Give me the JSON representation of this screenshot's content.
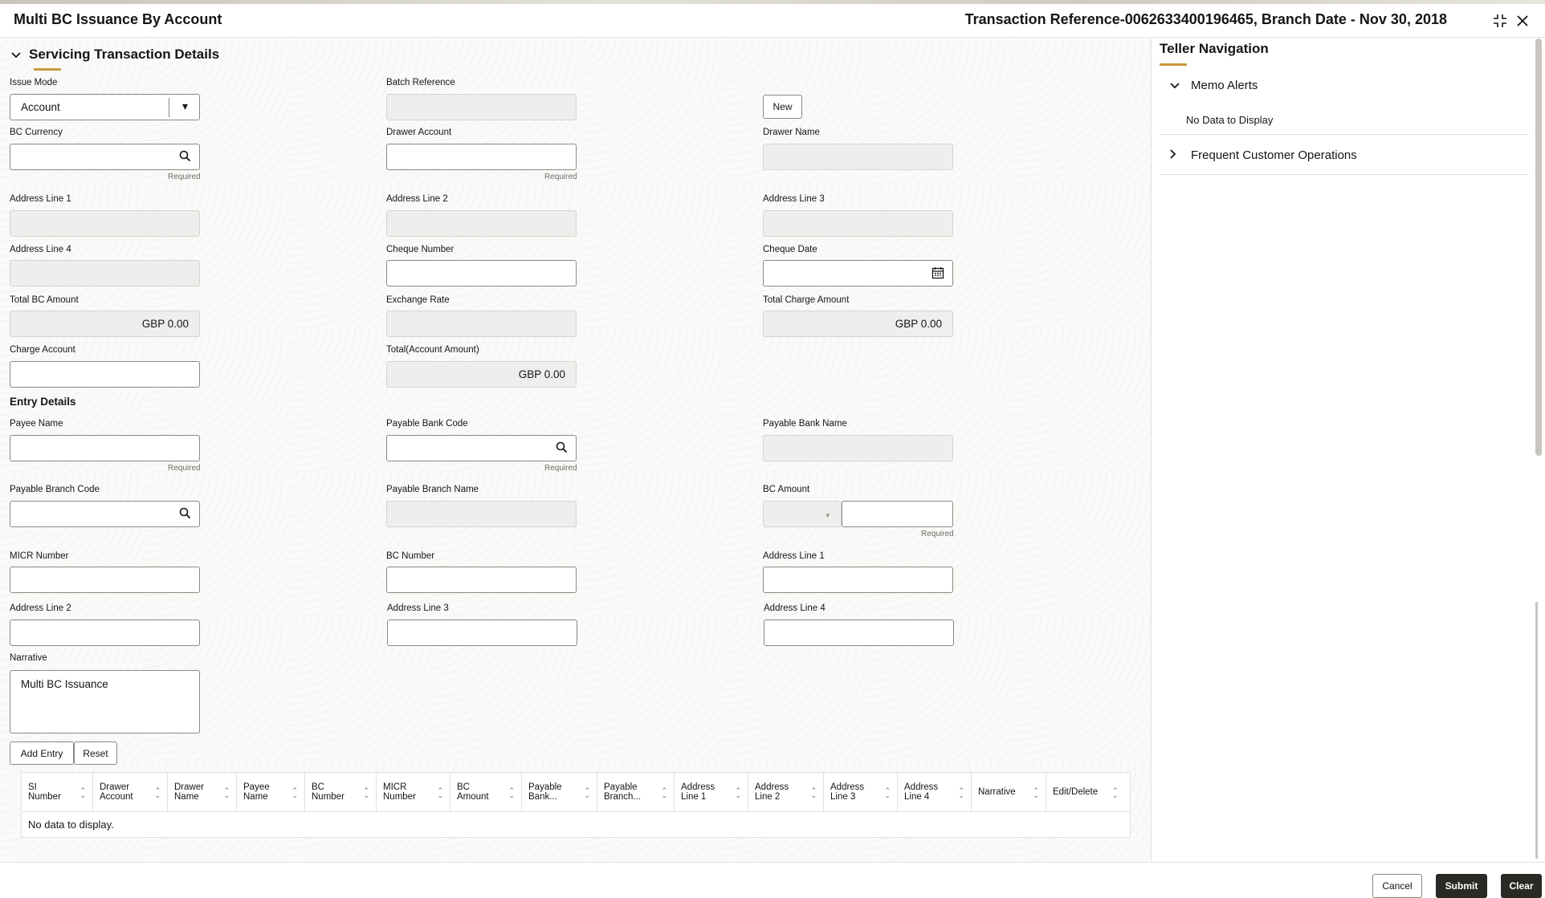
{
  "header": {
    "title": "Multi BC Issuance By Account",
    "reference": "Transaction Reference-0062633400196465, Branch Date - Nov 30, 2018",
    "icons": [
      "compress-icon",
      "close-icon"
    ]
  },
  "section": {
    "title": "Servicing Transaction Details",
    "chevron": "⌄"
  },
  "form": {
    "issue_mode": {
      "label": "Issue Mode",
      "value": "Account",
      "caret": "▾"
    },
    "batch_reference": {
      "label": "Batch Reference",
      "value": ""
    },
    "new_button": "New",
    "bc_currency": {
      "label": "BC Currency",
      "value": "",
      "required": "Required"
    },
    "drawer_account": {
      "label": "Drawer Account",
      "value": "",
      "required": "Required"
    },
    "drawer_name": {
      "label": "Drawer Name",
      "value": ""
    },
    "address_line_1": {
      "label": "Address Line 1",
      "value": ""
    },
    "address_line_2": {
      "label": "Address Line 2",
      "value": ""
    },
    "address_line_3": {
      "label": "Address Line 3",
      "value": ""
    },
    "address_line_4": {
      "label": "Address Line 4",
      "value": ""
    },
    "cheque_number": {
      "label": "Cheque Number",
      "value": ""
    },
    "cheque_date": {
      "label": "Cheque Date",
      "value": ""
    },
    "total_bc_amount": {
      "label": "Total BC Amount",
      "value": "GBP 0.00"
    },
    "exchange_rate": {
      "label": "Exchange Rate",
      "value": ""
    },
    "total_charge_amount": {
      "label": "Total Charge Amount",
      "value": "GBP 0.00"
    },
    "charge_account": {
      "label": "Charge Account",
      "value": ""
    },
    "total_account_amount": {
      "label": "Total(Account Amount)",
      "value": "GBP 0.00"
    }
  },
  "entry": {
    "title": "Entry Details",
    "payee_name": {
      "label": "Payee Name",
      "value": "",
      "required": "Required"
    },
    "payable_bank_code": {
      "label": "Payable Bank Code",
      "value": "",
      "required": "Required"
    },
    "payable_bank_name": {
      "label": "Payable Bank Name",
      "value": ""
    },
    "payable_branch_code": {
      "label": "Payable Branch Code",
      "value": ""
    },
    "payable_branch_name": {
      "label": "Payable Branch Name",
      "value": ""
    },
    "bc_amount": {
      "label": "BC Amount",
      "currency": "",
      "value": "",
      "required": "Required",
      "caret": "▾"
    },
    "micr_number": {
      "label": "MICR Number",
      "value": ""
    },
    "bc_number": {
      "label": "BC Number",
      "value": ""
    },
    "address_line_1": {
      "label": "Address Line 1",
      "value": ""
    },
    "address_line_2": {
      "label": "Address Line 2",
      "value": ""
    },
    "address_line_3": {
      "label": "Address Line 3",
      "value": ""
    },
    "address_line_4": {
      "label": "Address Line 4",
      "value": ""
    },
    "narrative": {
      "label": "Narrative",
      "value": "Multi BC Issuance"
    },
    "add_entry_button": "Add Entry",
    "reset_button": "Reset"
  },
  "table": {
    "columns": [
      [
        "SI",
        "Number"
      ],
      [
        "Drawer",
        "Account"
      ],
      [
        "Drawer",
        "Name"
      ],
      [
        "Payee",
        "Name"
      ],
      [
        "BC",
        "Number"
      ],
      [
        "MICR",
        "Number"
      ],
      [
        "BC",
        "Amount"
      ],
      [
        "Payable",
        "Bank..."
      ],
      [
        "Payable",
        "Branch..."
      ],
      [
        "Address",
        "Line 1"
      ],
      [
        "Address",
        "Line 2"
      ],
      [
        "Address",
        "Line 3"
      ],
      [
        "Address",
        "Line 4"
      ],
      [
        "Narrative",
        ""
      ],
      [
        "Edit/Delete",
        ""
      ]
    ],
    "empty": "No data to display."
  },
  "teller": {
    "title": "Teller Navigation",
    "memo_alerts": {
      "label": "Memo Alerts",
      "empty": "No Data to Display"
    },
    "frequent_ops": {
      "label": "Frequent Customer Operations"
    }
  },
  "footer": {
    "cancel": "Cancel",
    "submit": "Submit",
    "clear": "Clear"
  },
  "colors": {
    "accent": "#c99a3c",
    "primary_button": "#2b2926",
    "readonly_bg": "#efeeec"
  }
}
